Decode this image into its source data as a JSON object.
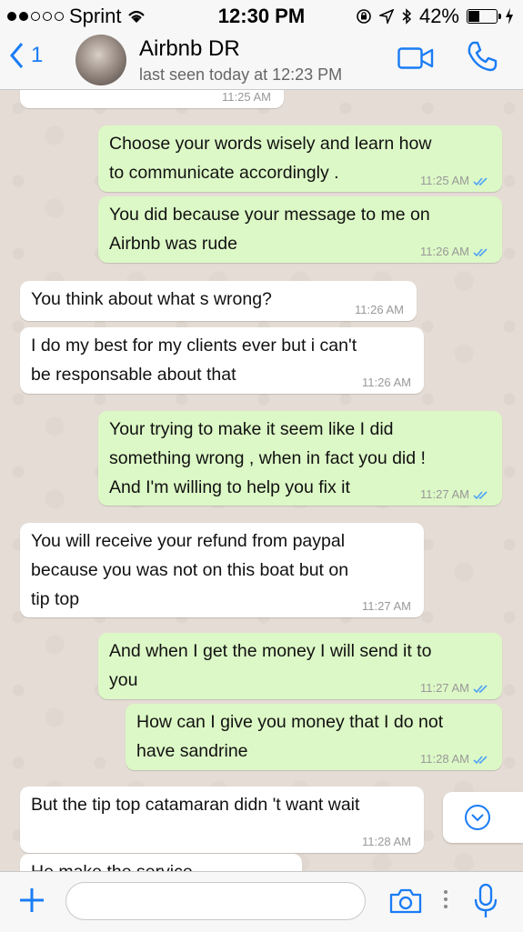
{
  "status_bar": {
    "carrier": "Sprint",
    "time": "12:30 PM",
    "battery_percent": "42%",
    "battery_level": 0.42,
    "signal_bars": 2
  },
  "header": {
    "back_count": "1",
    "contact_name": "Airbnb DR",
    "last_seen": "last seen today at 12:23 PM",
    "accent_color": "#1a7cf5"
  },
  "messages": [
    {
      "dir": "in",
      "text": "",
      "time": "11:25 AM"
    },
    {
      "dir": "out",
      "text": "Choose your words wisely and learn how\nto communicate accordingly .",
      "time": "11:25 AM"
    },
    {
      "dir": "out",
      "text": "You did because your message to me on\nAirbnb was rude",
      "time": "11:26 AM"
    },
    {
      "dir": "in",
      "text": "You think about what s wrong?",
      "time": "11:26 AM"
    },
    {
      "dir": "in",
      "text": "I do my best for my clients ever but i can't\nbe responsable about that",
      "time": "11:26 AM"
    },
    {
      "dir": "out",
      "text": "Your trying to make it seem like I did\nsomething wrong , when in fact you did !\nAnd I'm willing to help you fix it",
      "time": "11:27 AM"
    },
    {
      "dir": "in",
      "text": "You will receive your refund from paypal\nbecause you was not on this boat but on\ntip top",
      "time": "11:27 AM"
    },
    {
      "dir": "out",
      "text": "And when I get the money I will send it to\nyou",
      "time": "11:27 AM"
    },
    {
      "dir": "out",
      "text": "How can I give you money that I do not\nhave sandrine",
      "time": "11:28 AM"
    },
    {
      "dir": "in",
      "text": "But the tip top catamaran didn 't want wait",
      "time": "11:28 AM"
    },
    {
      "dir": "in",
      "text": "He make the service",
      "time": ""
    }
  ],
  "input": {
    "placeholder": "",
    "value": ""
  },
  "icons": {
    "back": "chevron-left-icon",
    "video": "video-call-icon",
    "phone": "phone-icon",
    "scroll": "scroll-down-icon",
    "plus": "plus-icon",
    "camera": "camera-icon",
    "more": "more-icon",
    "mic": "microphone-icon"
  },
  "colors": {
    "outgoing": "#dcf8c6",
    "incoming": "#ffffff",
    "read_ticks": "#4fa3f7"
  }
}
